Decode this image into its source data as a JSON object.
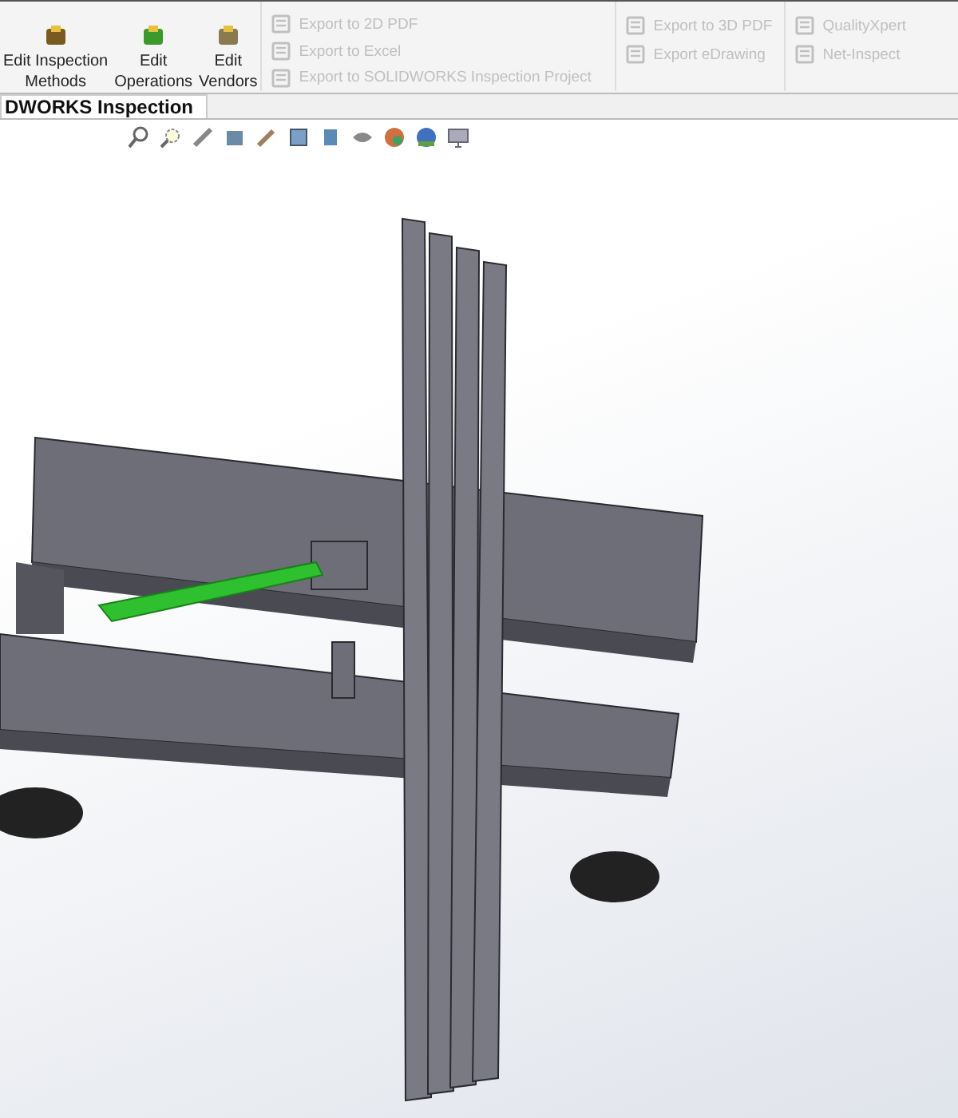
{
  "ribbon": {
    "big_buttons": [
      {
        "lines": [
          "Edit Inspection",
          "Methods"
        ],
        "kind": "methods",
        "disabled": false
      },
      {
        "lines": [
          "Edit",
          "Operations"
        ],
        "kind": "operations",
        "disabled": false
      },
      {
        "lines": [
          "Edit",
          "Vendors"
        ],
        "kind": "vendors",
        "disabled": false
      }
    ],
    "groups": [
      {
        "items": [
          {
            "label": "Export to 2D PDF",
            "disabled": true
          },
          {
            "label": "Export to Excel",
            "disabled": true
          },
          {
            "label": "Export to SOLIDWORKS Inspection Project",
            "disabled": true
          }
        ]
      },
      {
        "items": [
          {
            "label": "Export to 3D PDF",
            "disabled": true
          },
          {
            "label": "Export eDrawing",
            "disabled": true
          }
        ]
      },
      {
        "items": [
          {
            "label": "QualityXpert",
            "disabled": true
          },
          {
            "label": "Net-Inspect",
            "disabled": true
          }
        ]
      }
    ]
  },
  "tabs": [
    {
      "label": "DWORKS Inspection",
      "selected": true
    }
  ]
}
